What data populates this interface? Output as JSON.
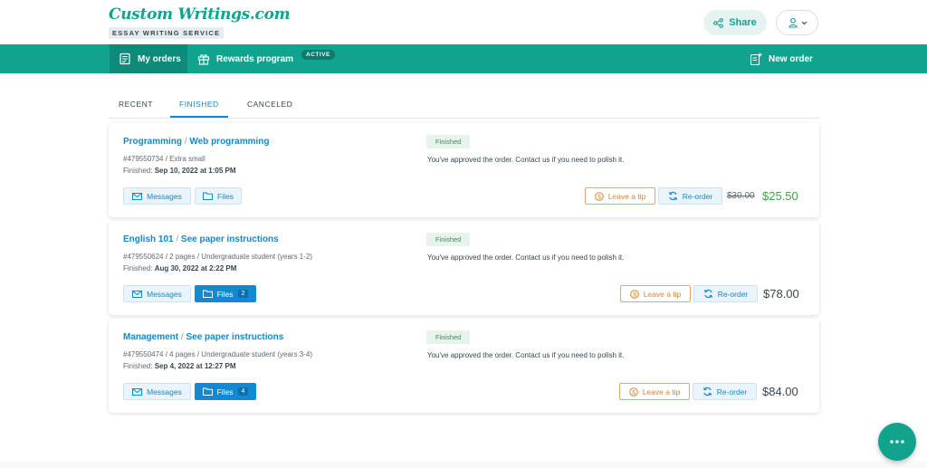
{
  "brand": {
    "name": "Custom Writings.com",
    "tagline": "ESSAY WRITING SERVICE"
  },
  "header": {
    "share_label": "Share"
  },
  "nav": {
    "my_orders": "My orders",
    "rewards": "Rewards program",
    "rewards_badge": "ACTIVE",
    "new_order": "New order"
  },
  "tabs": [
    {
      "label": "RECENT"
    },
    {
      "label": "FINISHED",
      "active": true
    },
    {
      "label": "CANCELED"
    }
  ],
  "orders": [
    {
      "subject": "Programming",
      "topic": "Web programming",
      "meta": "#479550734 / Extra small",
      "finished_prefix": "Finished: ",
      "finished_date": "Sep 10, 2022 at 1:05 PM",
      "status": "Finished",
      "status_msg": "You've approved the order. Contact us if you need to polish it.",
      "messages_label": "Messages",
      "files_label": "Files",
      "files_count": "",
      "tip_label": "Leave a tip",
      "reorder_label": "Re-order",
      "old_price": "$30.00",
      "price": "$25.50"
    },
    {
      "subject": "English 101",
      "topic": "See paper instructions",
      "meta": "#479550624 / 2 pages / Undergraduate student (years 1-2)",
      "finished_prefix": "Finished: ",
      "finished_date": "Aug 30, 2022 at 2:22 PM",
      "status": "Finished",
      "status_msg": "You've approved the order. Contact us if you need to polish it.",
      "messages_label": "Messages",
      "files_label": "Files",
      "files_count": "2",
      "tip_label": "Leave a tip",
      "reorder_label": "Re-order",
      "old_price": "",
      "price": "$78.00"
    },
    {
      "subject": "Management",
      "topic": "See paper instructions",
      "meta": "#479550474 / 4 pages / Undergraduate student (years 3-4)",
      "finished_prefix": "Finished: ",
      "finished_date": "Sep 4, 2022 at 12:27 PM",
      "status": "Finished",
      "status_msg": "You've approved the order. Contact us if you need to polish it.",
      "messages_label": "Messages",
      "files_label": "Files",
      "files_count": "4",
      "tip_label": "Leave a tip",
      "reorder_label": "Re-order",
      "old_price": "",
      "price": "$84.00"
    }
  ],
  "colors": {
    "brand": "#12a38f",
    "link": "#1489c8",
    "price_discount": "#3fa53f",
    "tip": "#e0822f"
  },
  "icons": [
    "share-icon",
    "user-icon",
    "chevron-down-icon",
    "orders-icon",
    "gift-icon",
    "new-order-icon",
    "envelope-icon",
    "folder-icon",
    "coin-icon",
    "refresh-icon",
    "more-icon"
  ]
}
